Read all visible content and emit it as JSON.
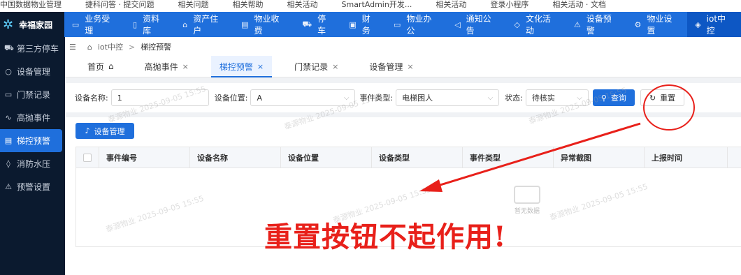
{
  "browser_bar": {
    "items": [
      "中国数据物业管理",
      "捷科问答 · 提交问题",
      "相关问题",
      "相关帮助",
      "相关活动",
      "SmartAdmin开发...",
      "相关活动",
      "登录小程序",
      "相关活动 · 文档"
    ]
  },
  "brand": {
    "name": "幸福家园",
    "icon": "gear-icon"
  },
  "top_nav": [
    {
      "label": "业务受理",
      "icon": "desk-icon"
    },
    {
      "label": "资料库",
      "icon": "book-icon"
    },
    {
      "label": "资产住户",
      "icon": "home-icon"
    },
    {
      "label": "物业收费",
      "icon": "bill-icon"
    },
    {
      "label": "停车",
      "icon": "car-icon"
    },
    {
      "label": "财务",
      "icon": "finance-icon"
    },
    {
      "label": "物业办公",
      "icon": "laptop-icon"
    },
    {
      "label": "通知公告",
      "icon": "megaphone-icon"
    },
    {
      "label": "文化活动",
      "icon": "tag-icon"
    },
    {
      "label": "设备预警",
      "icon": "alarm-icon"
    },
    {
      "label": "物业设置",
      "icon": "settings-icon"
    },
    {
      "label": "iot中控",
      "icon": "cube-icon",
      "active": true
    }
  ],
  "sidebar": [
    {
      "label": "第三方停车",
      "icon": "car-icon"
    },
    {
      "label": "设备管理",
      "icon": "bulb-icon"
    },
    {
      "label": "门禁记录",
      "icon": "card-icon"
    },
    {
      "label": "高抛事件",
      "icon": "trend-icon"
    },
    {
      "label": "梯控预警",
      "icon": "elevator-icon",
      "active": true
    },
    {
      "label": "消防水压",
      "icon": "drop-icon"
    },
    {
      "label": "预警设置",
      "icon": "alarm-icon"
    }
  ],
  "breadcrumb": {
    "menu_icon": "menu-icon",
    "home_icon": "home-icon",
    "level1": "iot中控",
    "separator": ">",
    "level2": "梯控预警"
  },
  "tabs": [
    {
      "label": "首页",
      "icon": "home-icon"
    },
    {
      "label": "高抛事件",
      "close": "×"
    },
    {
      "label": "梯控预警",
      "close": "×",
      "active": true
    },
    {
      "label": "门禁记录",
      "close": "×"
    },
    {
      "label": "设备管理",
      "close": "×"
    }
  ],
  "filters": {
    "device_name_label": "设备名称:",
    "device_name_value": "1",
    "location_label": "设备位置:",
    "location_value": "A",
    "event_type_label": "事件类型:",
    "event_type_value": "电梯困人",
    "status_label": "状态:",
    "status_value": "待核实",
    "search_label": "查询",
    "reset_label": "重置"
  },
  "toolbar": {
    "device_mgmt_label": "设备管理"
  },
  "table": {
    "columns": [
      "事件编号",
      "设备名称",
      "设备位置",
      "设备类型",
      "事件类型",
      "异常截图",
      "上报时间"
    ],
    "rows": [],
    "empty_text": "暂无数据"
  },
  "watermark": "泰源物业 2025-09-05 15:55",
  "annotation": {
    "text": "重置按钮不起作用!",
    "color": "#e8201a"
  },
  "colors": {
    "primary": "#1f6fdc",
    "sidebar": "#0b1a2f",
    "annotation": "#e8201a"
  }
}
